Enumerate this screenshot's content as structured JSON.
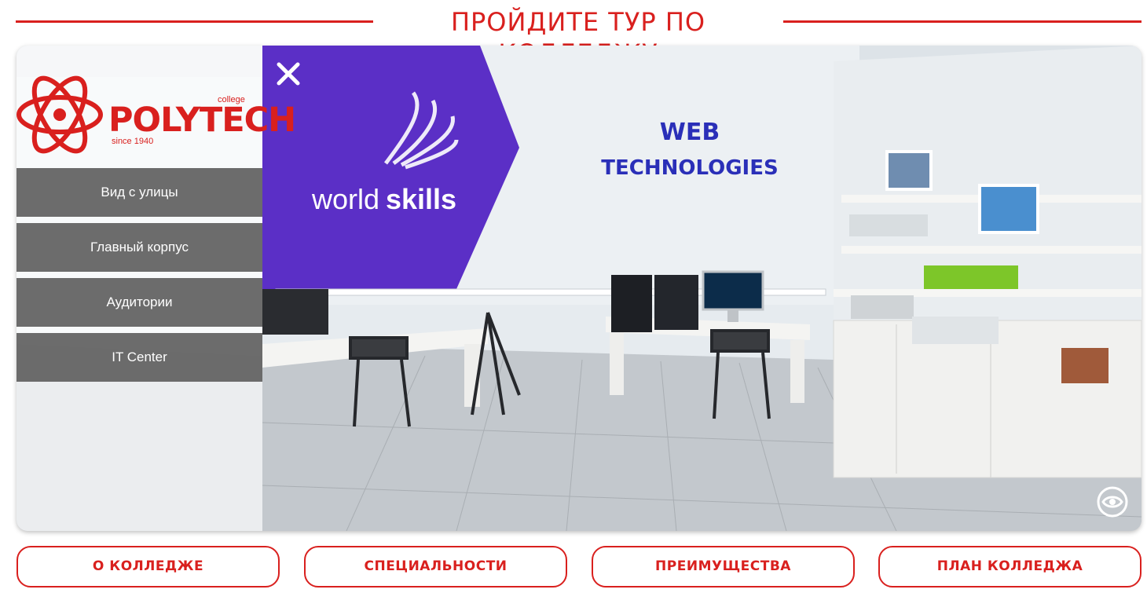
{
  "header": {
    "title": "ПРОЙДИТЕ ТУР ПО КОЛЛЕДЖУ"
  },
  "logo": {
    "brand": "POLYTECH",
    "college": "college",
    "since": "since 1940"
  },
  "sidebar": {
    "items": [
      {
        "label": "Вид с улицы"
      },
      {
        "label": "Главный корпус"
      },
      {
        "label": "Аудитории"
      },
      {
        "label": "IT Center"
      }
    ]
  },
  "scene": {
    "wall_sign_line1": "WEB",
    "wall_sign_line2": "TECHNOLOGIES",
    "banner_text_light": "world",
    "banner_text_bold": "skills"
  },
  "controls": {
    "close_icon": "close-icon",
    "view_icon": "eye-icon"
  },
  "bottom_nav": {
    "items": [
      {
        "label": "О КОЛЛЕДЖЕ"
      },
      {
        "label": "СПЕЦИАЛЬНОСТИ"
      },
      {
        "label": "ПРЕИМУЩЕСТВА"
      },
      {
        "label": "ПЛАН КОЛЛЕДЖА"
      }
    ]
  },
  "colors": {
    "accent": "#d9201e",
    "menu_bg": "#5f5f5f",
    "banner": "#5b2fc6",
    "sign": "#2a2fb8"
  }
}
